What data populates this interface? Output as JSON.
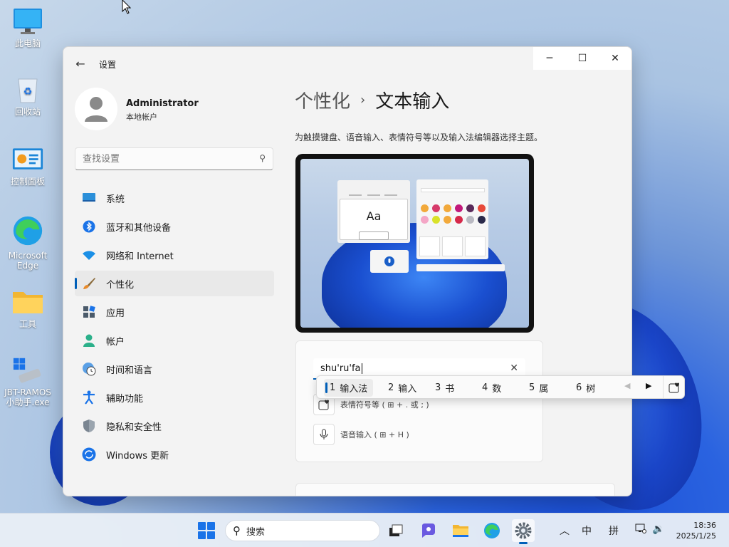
{
  "desktop": {
    "icons": [
      {
        "label": "此电脑"
      },
      {
        "label": "回收站"
      },
      {
        "label": "控制面板"
      },
      {
        "label": "Microsoft Edge"
      },
      {
        "label": "工具"
      },
      {
        "label": "JBT-RAMOS小助手.exe"
      }
    ]
  },
  "window": {
    "title": "设置",
    "controls": {
      "minimize": "─",
      "maximize": "☐",
      "close": "✕"
    }
  },
  "profile": {
    "name": "Administrator",
    "subtitle": "本地帐户"
  },
  "search": {
    "placeholder": "查找设置"
  },
  "nav": {
    "items": [
      {
        "label": "系统",
        "icon": "system-icon"
      },
      {
        "label": "蓝牙和其他设备",
        "icon": "bluetooth-icon"
      },
      {
        "label": "网络和 Internet",
        "icon": "wifi-icon"
      },
      {
        "label": "个性化",
        "icon": "brush-icon",
        "active": true
      },
      {
        "label": "应用",
        "icon": "apps-icon"
      },
      {
        "label": "帐户",
        "icon": "account-icon"
      },
      {
        "label": "时间和语言",
        "icon": "clock-globe-icon"
      },
      {
        "label": "辅助功能",
        "icon": "accessibility-icon"
      },
      {
        "label": "隐私和安全性",
        "icon": "shield-icon"
      },
      {
        "label": "Windows 更新",
        "icon": "update-icon"
      }
    ]
  },
  "content": {
    "breadcrumb_parent": "个性化",
    "breadcrumb_sep": "›",
    "breadcrumb_current": "文本输入",
    "description": "为触摸键盘、语音输入、表情符号等以及输入法编辑器选择主题。",
    "preview_sample": "Aa",
    "input_value": "shu'ru'fa",
    "option_emoji": "表情符号等 ( ⊞ + . 或 ; )",
    "option_voice": "语音输入 ( ⊞ + H )"
  },
  "ime": {
    "candidates": [
      {
        "num": "1",
        "text": "输入法",
        "selected": true
      },
      {
        "num": "2",
        "text": "输入"
      },
      {
        "num": "3",
        "text": "书"
      },
      {
        "num": "4",
        "text": "数"
      },
      {
        "num": "5",
        "text": "属"
      },
      {
        "num": "6",
        "text": "树"
      }
    ]
  },
  "taskbar": {
    "search_label": "搜索",
    "tray_lang": "中",
    "tray_ime": "拼",
    "time": "18:36",
    "date": "2025/1/25"
  },
  "colors": {
    "accent": "#005fb8"
  }
}
